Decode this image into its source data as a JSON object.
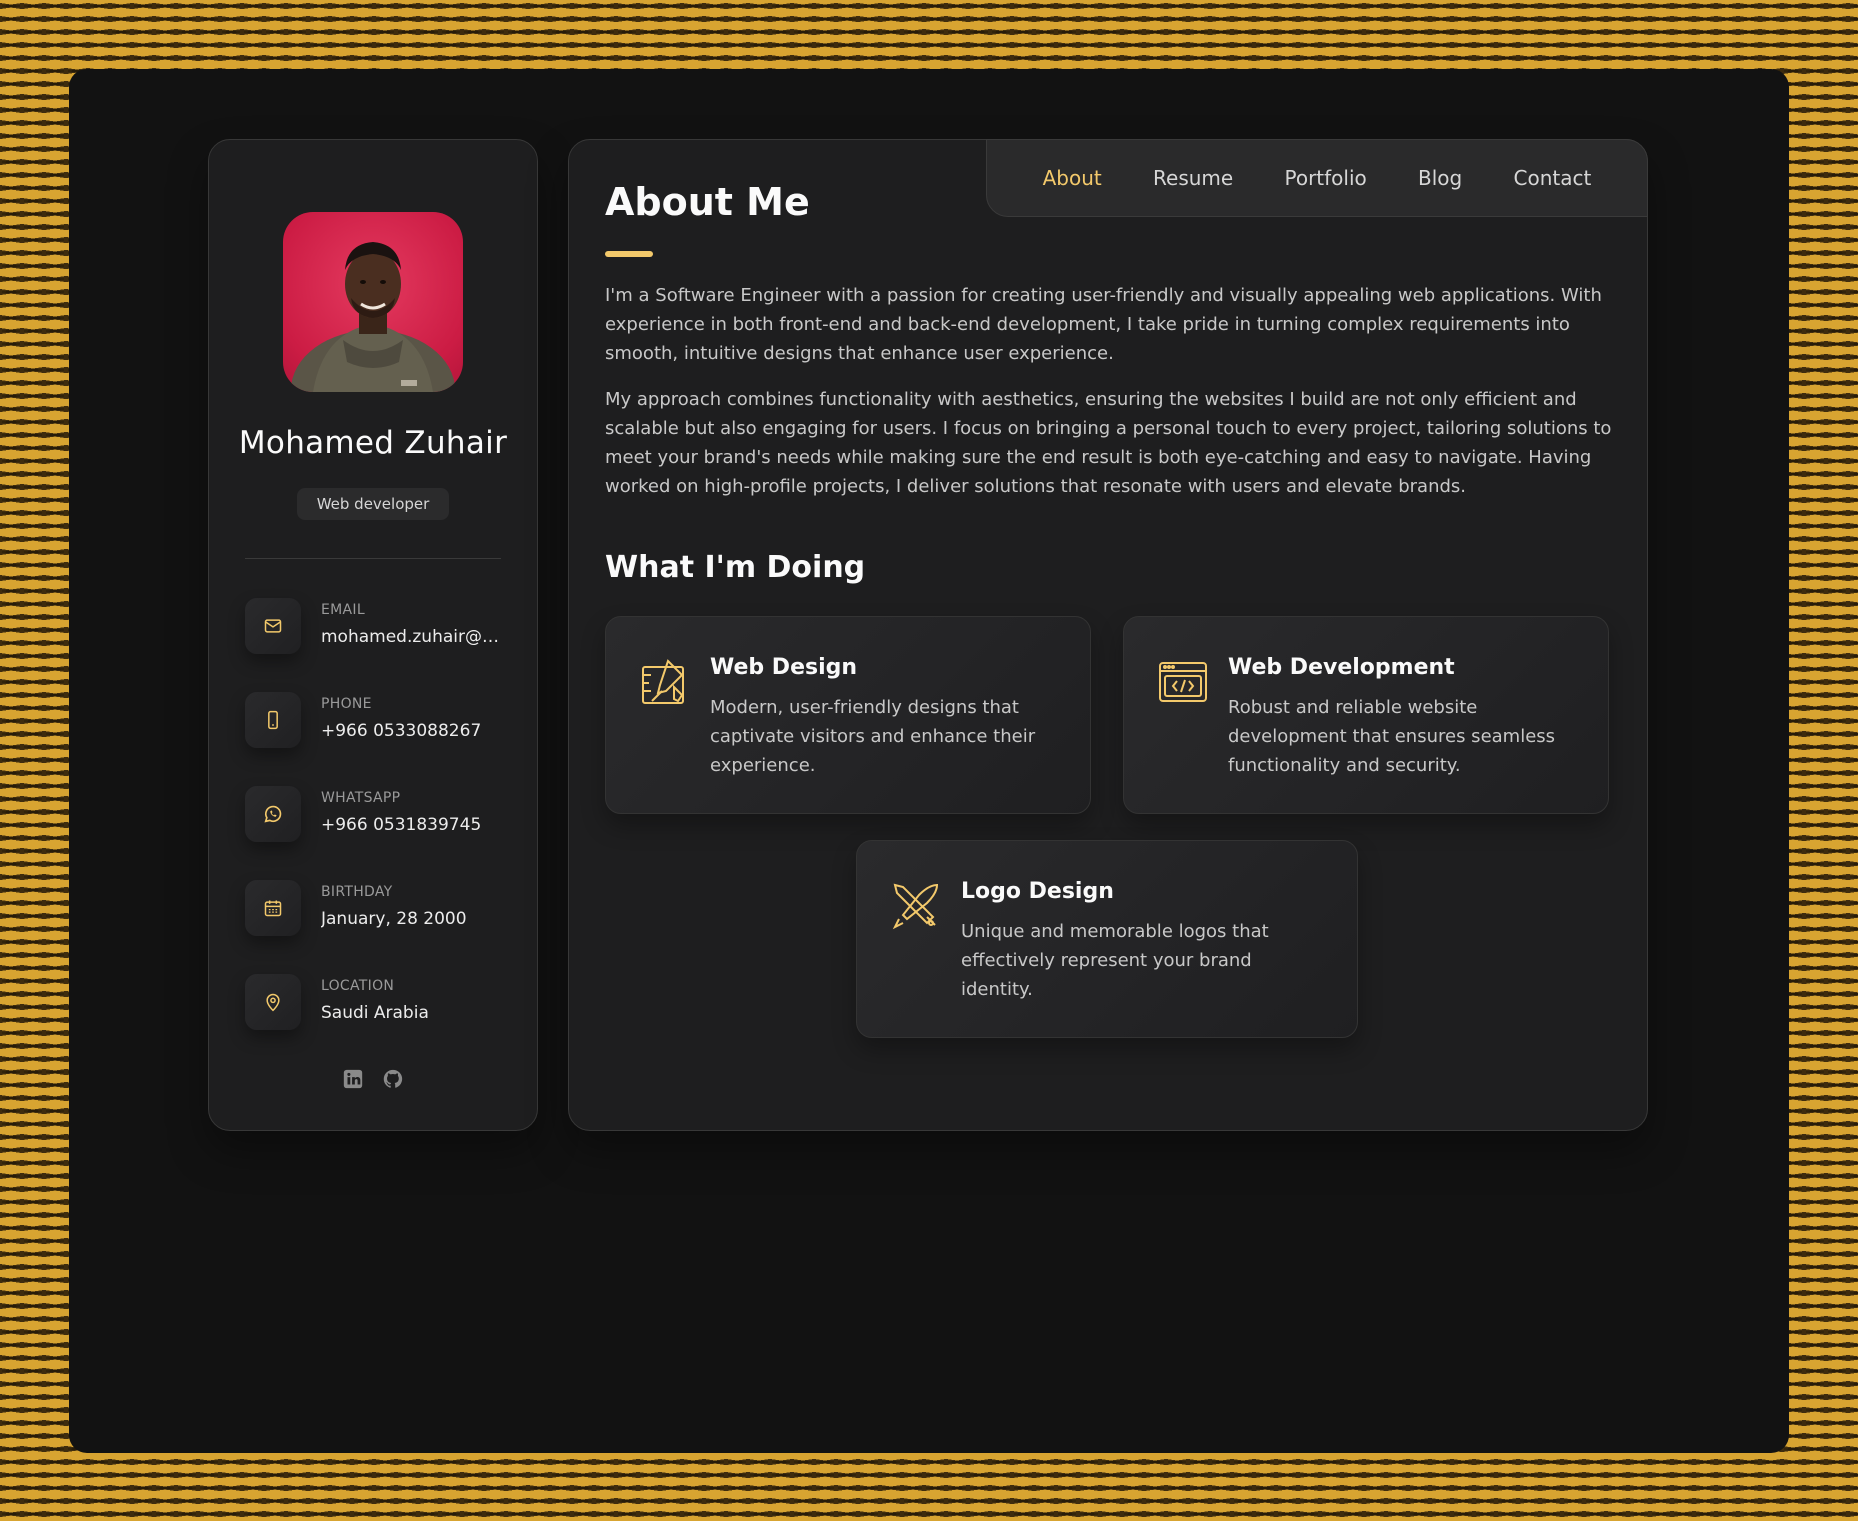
{
  "profile": {
    "name": "Mohamed Zuhair",
    "title": "Web developer"
  },
  "contacts": [
    {
      "label": "EMAIL",
      "value": "mohamed.zuhair@p...",
      "icon": "mail-icon"
    },
    {
      "label": "PHONE",
      "value": "+966 0533088267",
      "icon": "phone-icon"
    },
    {
      "label": "WHATSAPP",
      "value": "+966 0531839745",
      "icon": "whatsapp-icon"
    },
    {
      "label": "BIRTHDAY",
      "value": "January, 28 2000",
      "icon": "calendar-icon"
    },
    {
      "label": "LOCATION",
      "value": "Saudi Arabia",
      "icon": "location-pin-icon"
    }
  ],
  "socials": [
    "linkedin-icon",
    "github-icon"
  ],
  "nav": {
    "items": [
      "About",
      "Resume",
      "Portfolio",
      "Blog",
      "Contact"
    ],
    "active": "About"
  },
  "about": {
    "heading": "About Me",
    "paragraphs": [
      "I'm a Software Engineer with a passion for creating user-friendly and visually appealing web applications. With experience in both front-end and back-end development, I take pride in turning complex requirements into smooth, intuitive designs that enhance user experience.",
      "My approach combines functionality with aesthetics, ensuring the websites I build are not only efficient and scalable but also engaging for users. I focus on bringing a personal touch to every project, tailoring solutions to meet your brand's needs while making sure the end result is both eye-catching and easy to navigate. Having worked on high-profile projects, I deliver solutions that resonate with users and elevate brands."
    ]
  },
  "services": {
    "heading": "What I'm Doing",
    "items": [
      {
        "title": "Web Design",
        "text": "Modern, user-friendly designs that captivate visitors and enhance their experience.",
        "icon": "design-icon"
      },
      {
        "title": "Web Development",
        "text": "Robust and reliable website development that ensures seamless functionality and security.",
        "icon": "code-window-icon"
      },
      {
        "title": "Logo Design",
        "text": "Unique and memorable logos that effectively represent your brand identity.",
        "icon": "pen-tools-icon"
      }
    ]
  },
  "colors": {
    "accent": "#f3c96b",
    "background": "#121212",
    "card": "#1e1e1f",
    "pattern": "#d8a431"
  }
}
